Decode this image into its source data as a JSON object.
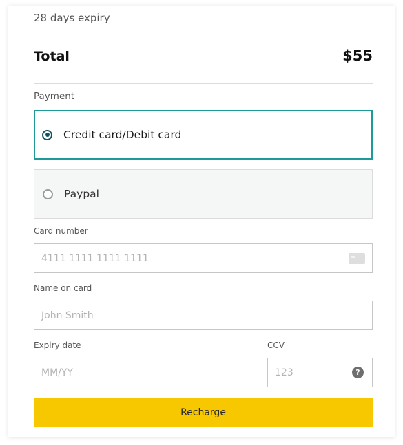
{
  "summary": {
    "expiry_text": "28 days expiry",
    "total_label": "Total",
    "total_amount": "$55"
  },
  "payment": {
    "section_label": "Payment",
    "options": [
      {
        "label": "Credit card/Debit card",
        "selected": true
      },
      {
        "label": "Paypal",
        "selected": false
      }
    ]
  },
  "form": {
    "card_number": {
      "label": "Card number",
      "placeholder": "4111 1111 1111 1111",
      "icon": "credit-card-icon"
    },
    "name_on_card": {
      "label": "Name on card",
      "placeholder": "John Smith"
    },
    "expiry_date": {
      "label": "Expiry date",
      "placeholder": "MM/YY"
    },
    "ccv": {
      "label": "CCV",
      "placeholder": "123",
      "help_icon_text": "?"
    }
  },
  "actions": {
    "recharge_label": "Recharge"
  },
  "colors": {
    "accent_border": "#1c9b98",
    "radio_selected": "#17535e",
    "button_bg": "#f7c700"
  }
}
